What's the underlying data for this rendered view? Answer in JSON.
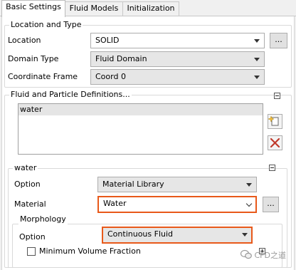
{
  "tabs": [
    {
      "label": "Basic Settings"
    },
    {
      "label": "Fluid Models"
    },
    {
      "label": "Initialization"
    }
  ],
  "location_group": {
    "title": "Location and Type",
    "location": {
      "label": "Location",
      "value": "SOLID",
      "button": "..."
    },
    "domain_type": {
      "label": "Domain Type",
      "value": "Fluid Domain"
    },
    "coordinate_frame": {
      "label": "Coordinate Frame",
      "value": "Coord 0"
    }
  },
  "fluid_group": {
    "title": "Fluid and Particle Definitions...",
    "items": [
      "water"
    ]
  },
  "water_group": {
    "title": "water",
    "option": {
      "label": "Option",
      "value": "Material Library"
    },
    "material": {
      "label": "Material",
      "value": "Water",
      "button": "..."
    }
  },
  "morphology_group": {
    "title": "Morphology",
    "option": {
      "label": "Option",
      "value": "Continuous Fluid"
    },
    "min_volume_fraction": {
      "label": "Minimum Volume Fraction",
      "checked": false
    }
  },
  "watermark": "CFD之道",
  "colors": {
    "highlight": "#e8591a",
    "delete_icon": "#c0392b"
  }
}
